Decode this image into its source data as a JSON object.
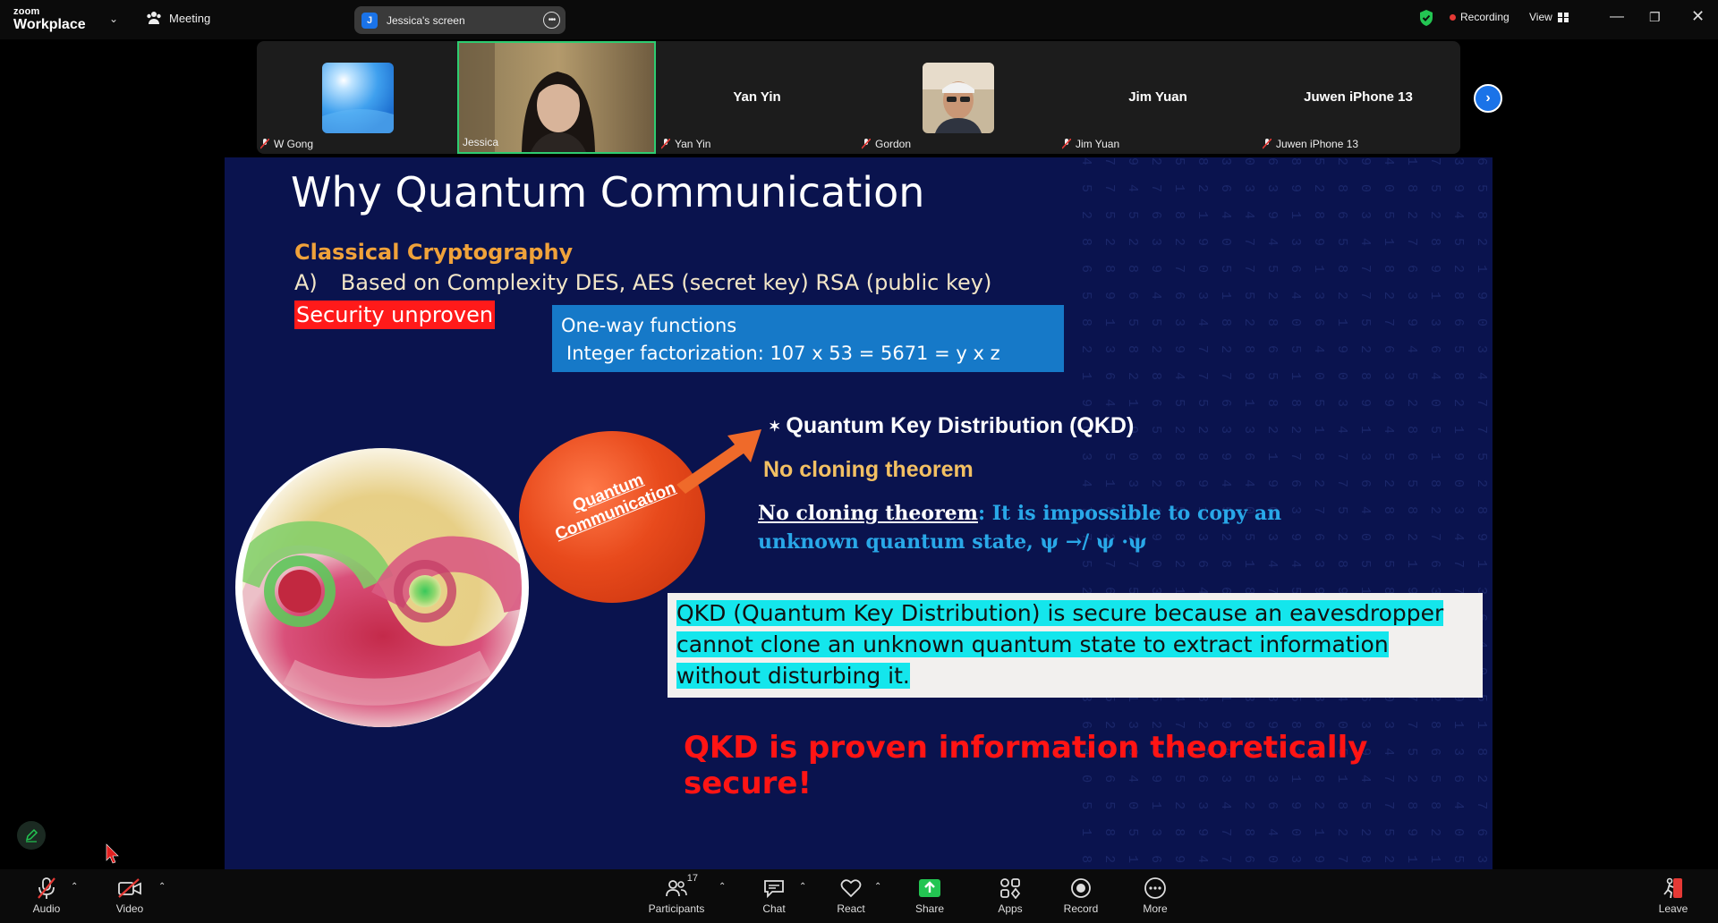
{
  "app": {
    "brand_top": "zoom",
    "brand_bottom": "Workplace",
    "meeting_label": "Meeting",
    "shared_screen_label": "Jessica's screen",
    "shared_screen_initial": "J",
    "recording_label": "Recording",
    "view_label": "View"
  },
  "participants": [
    {
      "name": "W Gong",
      "display": "avatar-sky",
      "muted": true
    },
    {
      "name": "Jessica",
      "display": "video",
      "muted": false,
      "active_speaker": true
    },
    {
      "name": "Yan Yin",
      "display": "name",
      "muted": true
    },
    {
      "name": "Gordon",
      "display": "avatar-photo",
      "muted": true
    },
    {
      "name": "Jim Yuan",
      "display": "name",
      "muted": true
    },
    {
      "name": "Juwen iPhone 13",
      "display": "name",
      "muted": true
    }
  ],
  "slide": {
    "title": "Why  Quantum Communication",
    "classical_heading": "Classical Cryptography",
    "basis_label": "A)",
    "basis_text": "Based on Complexity DES, AES (secret key) RSA (public key)",
    "security_unproven": "Security unproven",
    "oneway_line1": "One-way functions",
    "oneway_line2": "Integer factorization:   107 x 53 =  5671 = y x z",
    "bubble_text": "Quantum Communication",
    "qkd_heading": "Quantum Key Distribution (QKD)",
    "no_cloning_heading": "No cloning theorem",
    "theorem_label": "No cloning theorem",
    "theorem_text": ": It is impossible to copy an unknown quantum state, ψ →/ ψ ·ψ",
    "box_text": "QKD (Quantum Key Distribution) is secure because an eavesdropper cannot clone an unknown quantum state to extract information without disturbing it.",
    "proven_text": "QKD is proven information theoretically secure!"
  },
  "toolbar": {
    "audio": "Audio",
    "video": "Video",
    "participants": "Participants",
    "participant_count": "17",
    "chat": "Chat",
    "react": "React",
    "share": "Share",
    "apps": "Apps",
    "record": "Record",
    "more": "More",
    "leave": "Leave"
  },
  "colors": {
    "slide_bg": "#0a134e",
    "active_border": "#2ecc71",
    "share_green": "#23c552",
    "leave_red": "#e53935",
    "recording_dot": "#e53935"
  },
  "icons": [
    "chevron-down-icon",
    "meeting-icon",
    "more-icon",
    "shield-icon",
    "record-dot-icon",
    "grid-icon",
    "minimize-icon",
    "restore-icon",
    "close-icon",
    "mic-off-icon",
    "next-icon",
    "annotate-icon",
    "cursor-icon",
    "video-off-icon",
    "participants-icon",
    "chat-icon",
    "react-icon",
    "share-icon",
    "apps-icon",
    "record-icon",
    "more-icon",
    "leave-icon"
  ]
}
